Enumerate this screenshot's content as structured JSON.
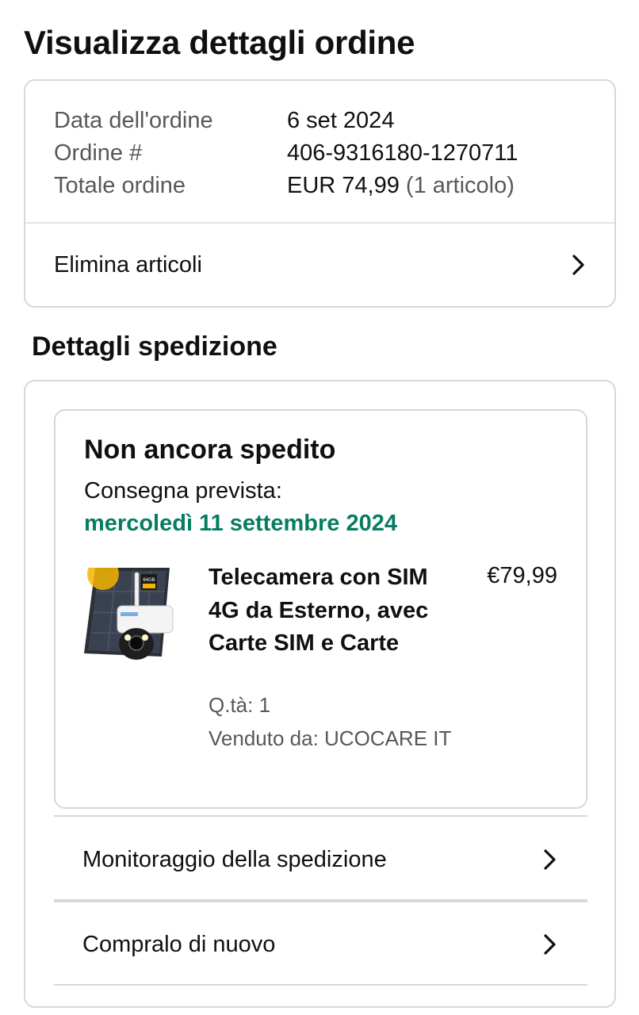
{
  "page": {
    "title": "Visualizza dettagli ordine"
  },
  "order": {
    "date_label": "Data dell'ordine",
    "date_value": "6 set 2024",
    "number_label": "Ordine #",
    "number_value": "406-9316180-1270711",
    "total_label": "Totale ordine",
    "total_value": "EUR 74,99",
    "total_items": "(1 articolo)",
    "delete_items_label": "Elimina articoli"
  },
  "shipment": {
    "section_title": "Dettagli spedizione",
    "status": "Non ancora spedito",
    "delivery_label": "Consegna prevista:",
    "delivery_date": "mercoledì 11 settembre 2024",
    "product": {
      "title": "Telecamera con SIM 4G da Esterno, avec Carte SIM e Carte",
      "price": "€79,99",
      "quantity": "Q.tà: 1",
      "seller": "Venduto da: UCOCARE IT",
      "image_badge": "64GB"
    },
    "track_label": "Monitoraggio della spedizione",
    "buy_again_label": "Compralo di nuovo"
  },
  "colors": {
    "delivery_green": "#067d62",
    "muted_text": "#565959",
    "border": "#d5d9d9"
  },
  "icons": {
    "chevron": "chevron-right-icon"
  }
}
